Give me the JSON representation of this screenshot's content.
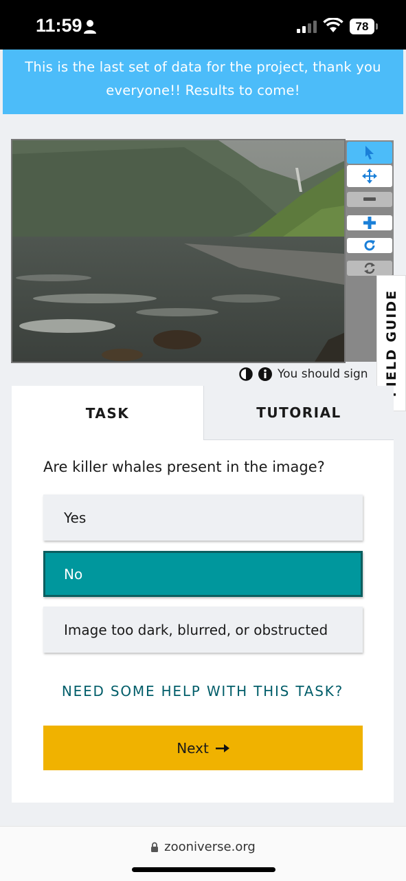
{
  "status_bar": {
    "time": "11:59",
    "battery": "78"
  },
  "announcement": {
    "line1": "This is the last set of data for the project, thank you",
    "line2": "everyone!! Results to come!"
  },
  "viewer_toolbar": [
    "select-tool",
    "pan-tool",
    "zoom-out",
    "zoom-in",
    "rotate",
    "reset"
  ],
  "image_meta": {
    "text": "You should sign"
  },
  "field_guide": {
    "label": "FIELD GUIDE"
  },
  "tabs": {
    "task": "TASK",
    "tutorial": "TUTORIAL"
  },
  "task": {
    "question": "Are killer whales present in the image?",
    "answers": [
      {
        "label": "Yes",
        "selected": false
      },
      {
        "label": "No",
        "selected": true
      },
      {
        "label": "Image too dark, blurred, or obstructed",
        "selected": false
      }
    ],
    "help": "NEED SOME HELP WITH THIS TASK?",
    "next": "Next"
  },
  "browser": {
    "url": "zooniverse.org"
  },
  "colors": {
    "announcement": "#4cbcf9",
    "selected": "#00979d",
    "next": "#f0b200",
    "help": "#005d69"
  }
}
